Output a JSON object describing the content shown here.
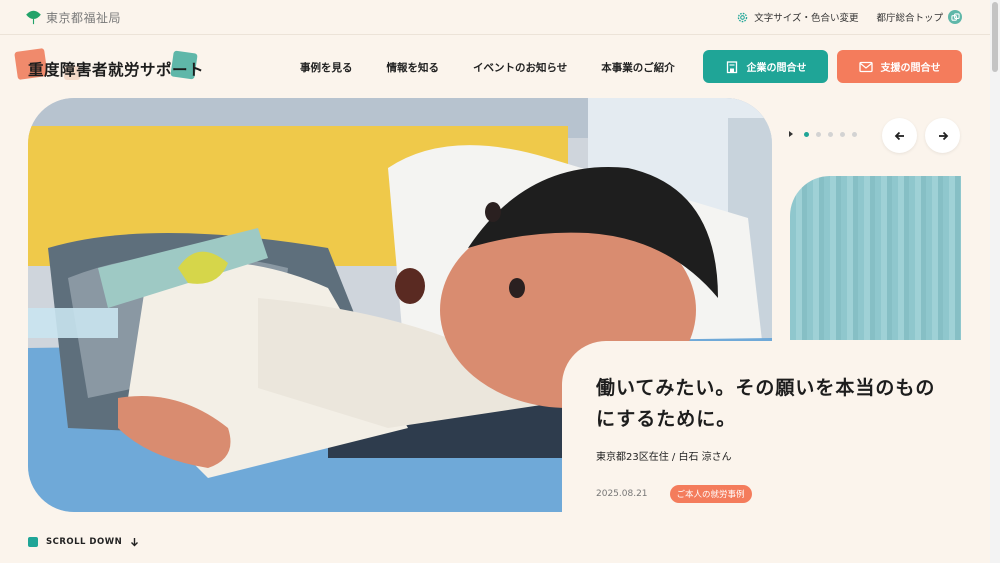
{
  "topbar": {
    "brand_name": "東京都福祉局",
    "text_size_label": "文字サイズ・色合い変更",
    "top_link_label": "都庁総合トップ"
  },
  "header": {
    "logo_text": "重度障害者就労サポート",
    "nav": [
      {
        "label": "事例を見る"
      },
      {
        "label": "情報を知る"
      },
      {
        "label": "イベントのお知らせ"
      },
      {
        "label": "本事業のご紹介"
      }
    ],
    "company_button": "企業の問合せ",
    "support_button": "支援の問合せ"
  },
  "hero": {
    "title_line1": "働いてみたい。その願いを本当のもの",
    "title_line2": "にするために。",
    "person": "東京都23区在住 / 白石 涼さん",
    "date": "2025.08.21",
    "tag": "ご本人の就労事例"
  },
  "slider": {
    "slide_count": 5,
    "active_index": 0
  },
  "scroll_label": "SCROLL DOWN",
  "colors": {
    "background": "#fbf4ec",
    "teal": "#1fa597",
    "coral": "#f47c5c"
  }
}
